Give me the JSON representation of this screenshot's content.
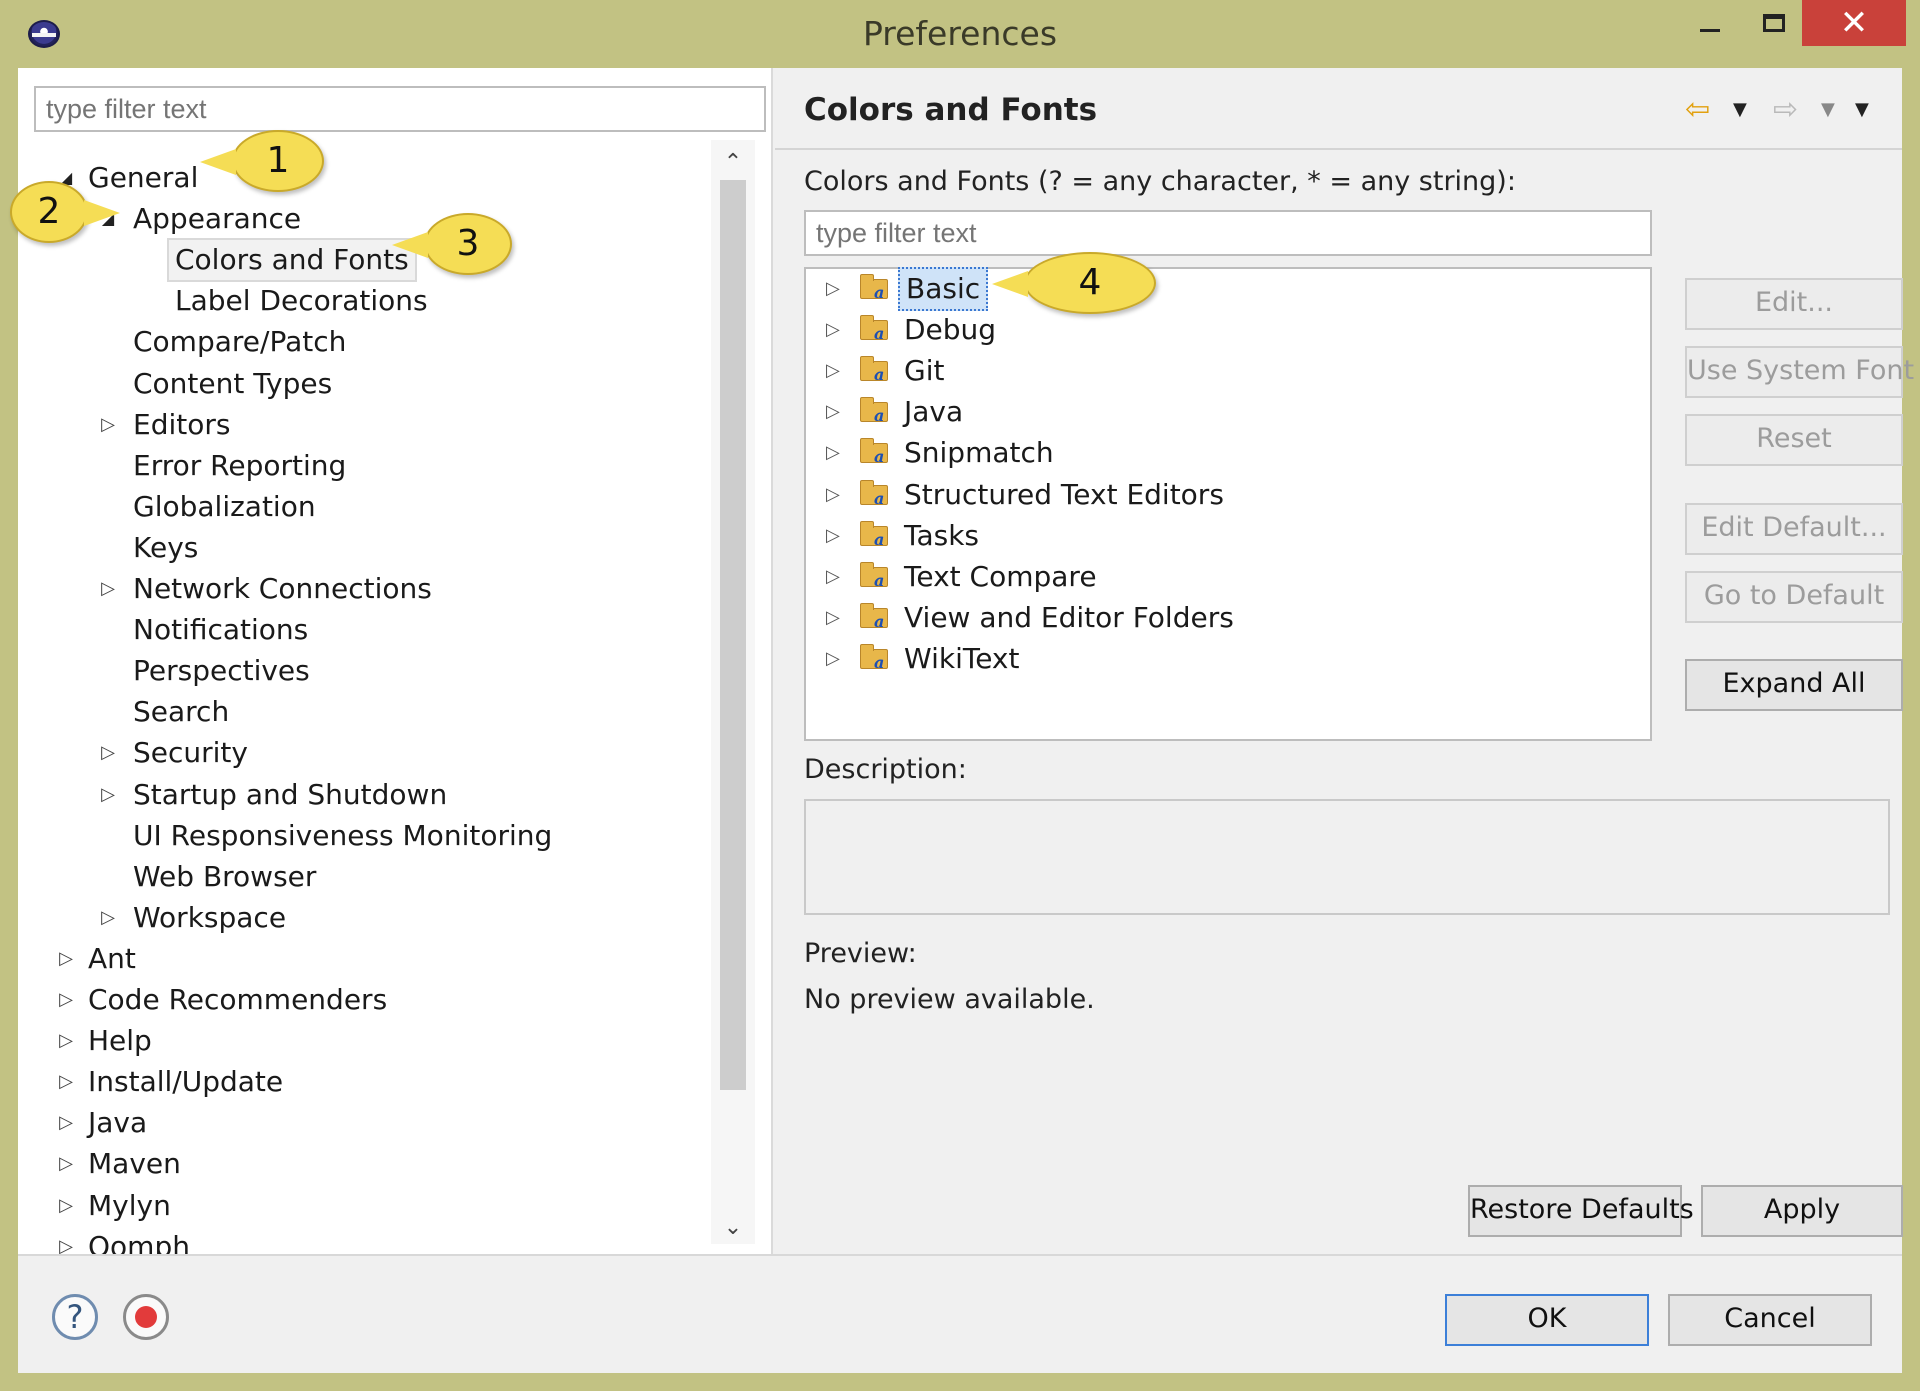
{
  "window": {
    "title": "Preferences",
    "minimize_icon": "minimize-icon",
    "maximize_icon": "maximize-icon",
    "close_label": "✕"
  },
  "left": {
    "filter_placeholder": "type filter text",
    "tree": [
      {
        "label": "General",
        "level": 0,
        "twisty": "open"
      },
      {
        "label": "Appearance",
        "level": 1,
        "twisty": "open"
      },
      {
        "label": "Colors and Fonts",
        "level": 2,
        "twisty": "none",
        "selected": true
      },
      {
        "label": "Label Decorations",
        "level": 2,
        "twisty": "none"
      },
      {
        "label": "Compare/Patch",
        "level": 1,
        "twisty": "none"
      },
      {
        "label": "Content Types",
        "level": 1,
        "twisty": "none"
      },
      {
        "label": "Editors",
        "level": 1,
        "twisty": "closed"
      },
      {
        "label": "Error Reporting",
        "level": 1,
        "twisty": "none"
      },
      {
        "label": "Globalization",
        "level": 1,
        "twisty": "none"
      },
      {
        "label": "Keys",
        "level": 1,
        "twisty": "none"
      },
      {
        "label": "Network Connections",
        "level": 1,
        "twisty": "closed"
      },
      {
        "label": "Notifications",
        "level": 1,
        "twisty": "none"
      },
      {
        "label": "Perspectives",
        "level": 1,
        "twisty": "none"
      },
      {
        "label": "Search",
        "level": 1,
        "twisty": "none"
      },
      {
        "label": "Security",
        "level": 1,
        "twisty": "closed"
      },
      {
        "label": "Startup and Shutdown",
        "level": 1,
        "twisty": "closed"
      },
      {
        "label": "UI Responsiveness Monitoring",
        "level": 1,
        "twisty": "none"
      },
      {
        "label": "Web Browser",
        "level": 1,
        "twisty": "none"
      },
      {
        "label": "Workspace",
        "level": 1,
        "twisty": "closed"
      },
      {
        "label": "Ant",
        "level": 0,
        "twisty": "closed"
      },
      {
        "label": "Code Recommenders",
        "level": 0,
        "twisty": "closed"
      },
      {
        "label": "Help",
        "level": 0,
        "twisty": "closed"
      },
      {
        "label": "Install/Update",
        "level": 0,
        "twisty": "closed"
      },
      {
        "label": "Java",
        "level": 0,
        "twisty": "closed"
      },
      {
        "label": "Maven",
        "level": 0,
        "twisty": "closed"
      },
      {
        "label": "Mylyn",
        "level": 0,
        "twisty": "closed"
      },
      {
        "label": "Oomph",
        "level": 0,
        "twisty": "closed"
      }
    ]
  },
  "right": {
    "title": "Colors and Fonts",
    "filter_label": "Colors and Fonts (? = any character, * = any string):",
    "filter_placeholder": "type filter text",
    "categories": [
      {
        "label": "Basic",
        "selected": true
      },
      {
        "label": "Debug"
      },
      {
        "label": "Git"
      },
      {
        "label": "Java"
      },
      {
        "label": "Snipmatch"
      },
      {
        "label": "Structured Text Editors"
      },
      {
        "label": "Tasks"
      },
      {
        "label": "Text Compare"
      },
      {
        "label": "View and Editor Folders"
      },
      {
        "label": "WikiText"
      }
    ],
    "buttons": {
      "edit": "Edit...",
      "use_system_font": "Use System Font",
      "reset": "Reset",
      "edit_default": "Edit Default...",
      "go_to_default": "Go to Default",
      "expand_all": "Expand All",
      "restore_defaults": "Restore Defaults",
      "apply": "Apply"
    },
    "description_label": "Description:",
    "preview_label": "Preview:",
    "preview_text": "No preview available."
  },
  "footer": {
    "ok": "OK",
    "cancel": "Cancel",
    "help_icon": "help-icon",
    "record_icon": "record-icon"
  },
  "callouts": [
    "1",
    "2",
    "3",
    "4"
  ],
  "colors": {
    "frame": "#c2c283",
    "close": "#c9413a",
    "callout": "#f5dd55",
    "selection": "#cfe3f8"
  }
}
